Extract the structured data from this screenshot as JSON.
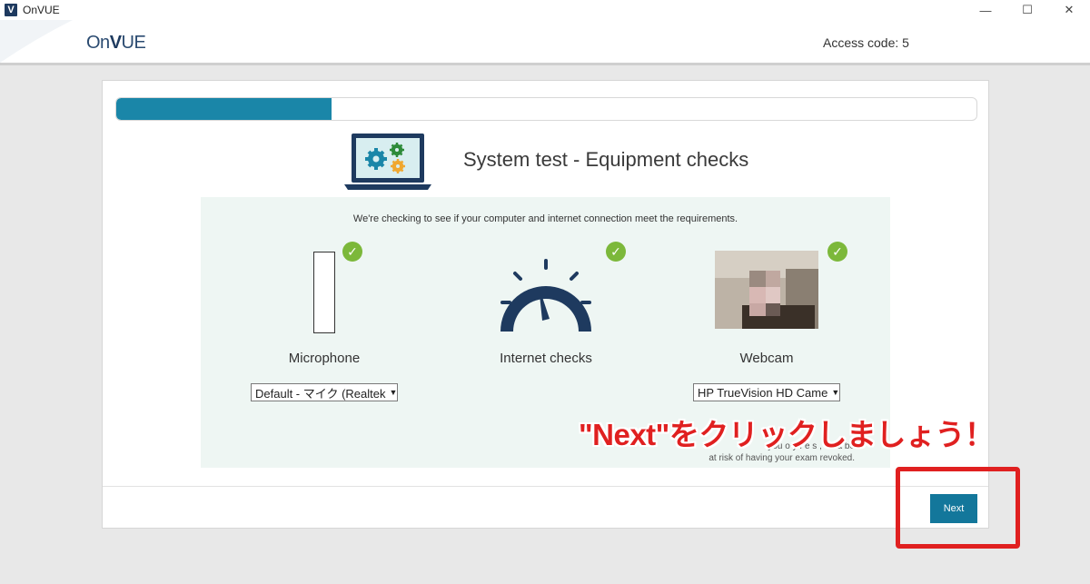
{
  "window": {
    "app_icon_letter": "V",
    "title": "OnVUE",
    "controls": {
      "minimize": "—",
      "maximize": "☐",
      "close": "✕"
    }
  },
  "header": {
    "logo_prefix": "On",
    "logo_v": "V",
    "logo_suffix": "UE",
    "access_code": "Access code: 5"
  },
  "progress": {
    "fraction": 0.25
  },
  "main": {
    "title": "System test - Equipment checks",
    "message": "We're checking to see if your computer and internet connection meet the requirements.",
    "checks": [
      {
        "label": "Microphone",
        "status": "passed",
        "select_value": "Default - マイク (Realtek"
      },
      {
        "label": "Internet checks",
        "status": "passed"
      },
      {
        "label": "Webcam",
        "status": "passed",
        "select_value": "HP TrueVision HD Came"
      }
    ],
    "note_line1": "you  o   y  f  e   s  ,  ou  a  be",
    "note_line2": "at risk of having your exam revoked."
  },
  "footer": {
    "next_label": "Next"
  },
  "annotation": {
    "text": "\"Next\"をクリックしましょう！",
    "color": "#e02020"
  },
  "colors": {
    "accent": "#13779b",
    "progress": "#1a86a8",
    "check": "#7cb83a",
    "panel_bg": "#eef6f3",
    "navy": "#1e3a5f"
  },
  "icons": [
    "laptop-gears-icon",
    "speedometer-icon",
    "check-icon",
    "dropdown-arrow-icon"
  ]
}
